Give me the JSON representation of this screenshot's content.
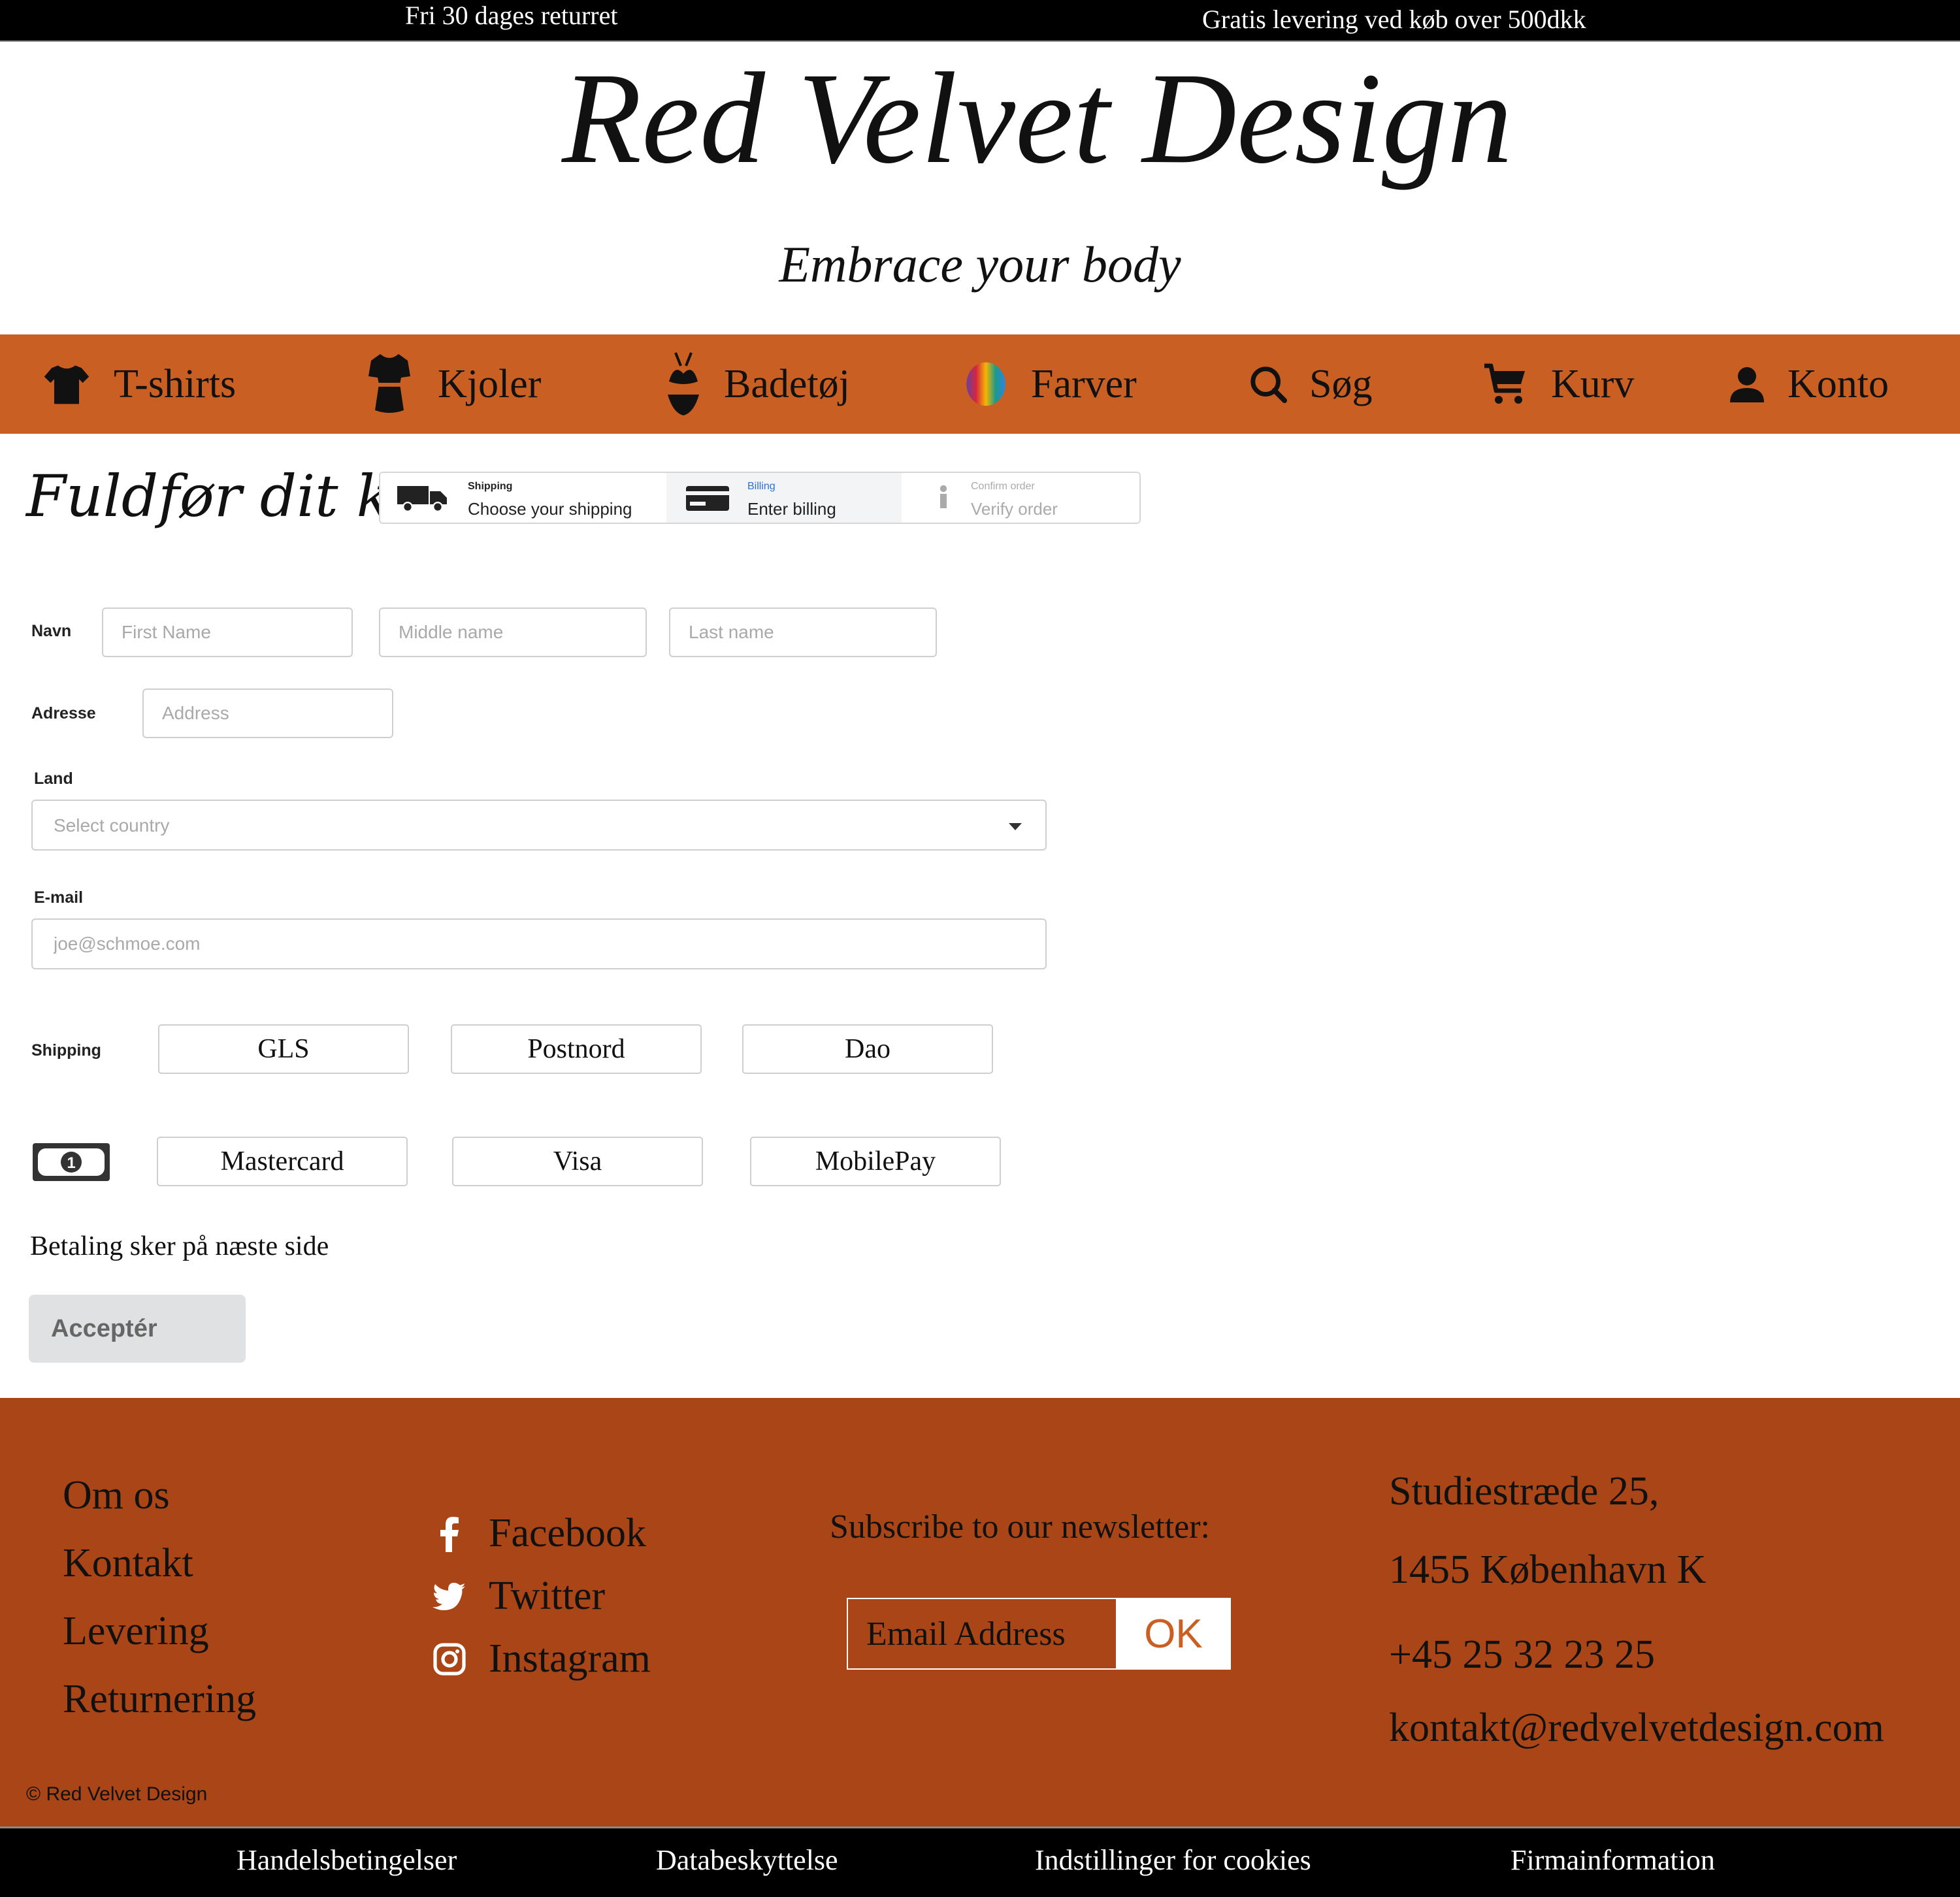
{
  "topbar": {
    "left_text": "Fri 30 dages returret",
    "right_text": "Gratis levering ved køb over 500dkk"
  },
  "header": {
    "logo_title": "Red Velvet Design",
    "tagline": "Embrace your body"
  },
  "nav": {
    "items": [
      {
        "label": "T-shirts",
        "icon": "tshirt-icon"
      },
      {
        "label": "Kjoler",
        "icon": "dress-icon"
      },
      {
        "label": "Badetøj",
        "icon": "bikini-icon"
      },
      {
        "label": "Farver",
        "icon": "color-swatch-icon"
      },
      {
        "label": "Søg",
        "icon": "search-icon"
      },
      {
        "label": "Kurv",
        "icon": "cart-icon"
      },
      {
        "label": "Konto",
        "icon": "account-icon"
      }
    ]
  },
  "checkout": {
    "title": "Fuldfør dit køb",
    "steps": [
      {
        "small": "Shipping",
        "big": "Choose your shipping",
        "icon": "truck-icon",
        "state": "completed"
      },
      {
        "small": "Billing",
        "big": "Enter billing",
        "icon": "credit-card-icon",
        "state": "active"
      },
      {
        "small": "Confirm order",
        "big": "Verify order",
        "icon": "info-icon",
        "state": "disabled"
      }
    ]
  },
  "form": {
    "name_label": "Navn",
    "first_name_placeholder": "First Name",
    "middle_name_placeholder": "Middle name",
    "last_name_placeholder": "Last name",
    "address_label": "Adresse",
    "address_placeholder": "Address",
    "country_label": "Land",
    "country_placeholder": "Select country",
    "email_label": "E-mail",
    "email_placeholder": "joe@schmoe.com",
    "shipping_label": "Shipping",
    "shipping_options": [
      "GLS",
      "Postnord",
      "Dao"
    ],
    "payment_icon": "money-bill-icon",
    "payment_options": [
      "Mastercard",
      "Visa",
      "MobilePay"
    ],
    "payment_note": "Betaling sker på næste side",
    "accept_label": "Acceptér"
  },
  "footer": {
    "links": [
      "Om os",
      "Kontakt",
      "Levering",
      "Returnering"
    ],
    "social": [
      {
        "label": "Facebook",
        "icon": "facebook-icon"
      },
      {
        "label": "Twitter",
        "icon": "twitter-icon"
      },
      {
        "label": "Instagram",
        "icon": "instagram-icon"
      }
    ],
    "newsletter_title": "Subscribe to our newsletter:",
    "newsletter_placeholder": "Email Address",
    "newsletter_button": "OK",
    "address_line1": "Studiestræde 25,",
    "address_line2": "1455 København K",
    "phone": "+45 25 32 23 25",
    "email": "kontakt@redvelvetdesign.com",
    "copyright": "© Red Velvet Design"
  },
  "bottombar": {
    "links": [
      "Handelsbetingelser",
      "Databeskyttelse",
      "Indstillinger for cookies",
      "Firmainformation"
    ]
  },
  "colors": {
    "nav_orange": "#c95f22",
    "footer_rust": "#a94516",
    "billing_blue": "#2f6fd6",
    "bar_black": "#000000"
  }
}
